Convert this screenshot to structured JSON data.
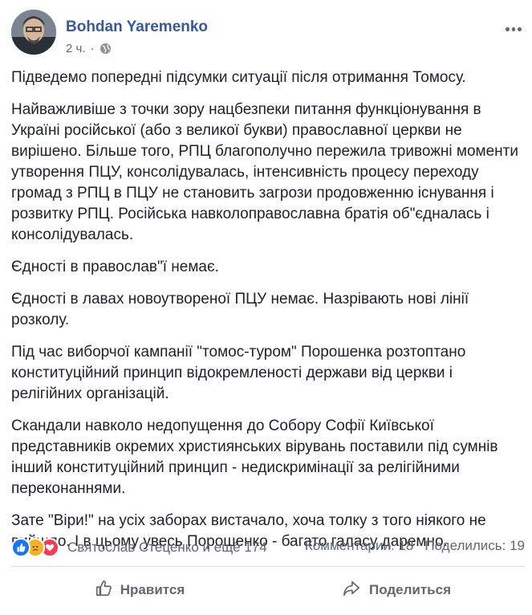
{
  "post": {
    "author": "Bohdan Yaremenko",
    "time": "2 ч.",
    "separator": "·",
    "privacy_icon": "globe-icon",
    "paragraphs": [
      "Підведемо попередні підсумки ситуації після отримання Томосу.",
      "Найважливіше з точки зору нацбезпеки питання функціонування в Україні російської (або з великої букви) православної церкви не вирішено. Більше того, РПЦ благополучно пережила тривожні моменти утворення ПЦУ, консолідувалась, інтенсивність процесу переходу громад з РПЦ в ПЦУ не становить загрози продовженню існування і розвитку РПЦ. Російська навколоправославна братія об\"єдналась і консолідувалась.",
      "Єдності в православ\"ї немає.",
      "Єдності в лавах новоутвореної ПЦУ немає. Назрівають нові лінії розколу.",
      "Під час виборчої кампанії \"томос-туром\" Порошенка розтоптано конституційний принцип відокремленості держави від церкви і релігійних організацій.",
      "Скандали навколо недопущення до Собору Софії Київської представників окремих християнських вірувань поставили під сумнів інший конституційний принцип - недискримінації за релігійними переконаннями.",
      "Зате \"Віри!\" на усіх заборах вистачало, хоча толку з того ніякого не вийшло. І в цьому увесь Порошенко - багато галасу даремно."
    ]
  },
  "stats": {
    "reactions_text": "Святослав Стеценко и ещё 174",
    "comments": "Комментарии: 18",
    "shares": "Поделились: 19"
  },
  "actions": {
    "like_label": "Нравится",
    "share_label": "Поделиться"
  },
  "colors": {
    "author": "#385898",
    "muted": "#606770",
    "like": "#1877f2",
    "sad": "#f7b125",
    "love": "#f33e58"
  }
}
